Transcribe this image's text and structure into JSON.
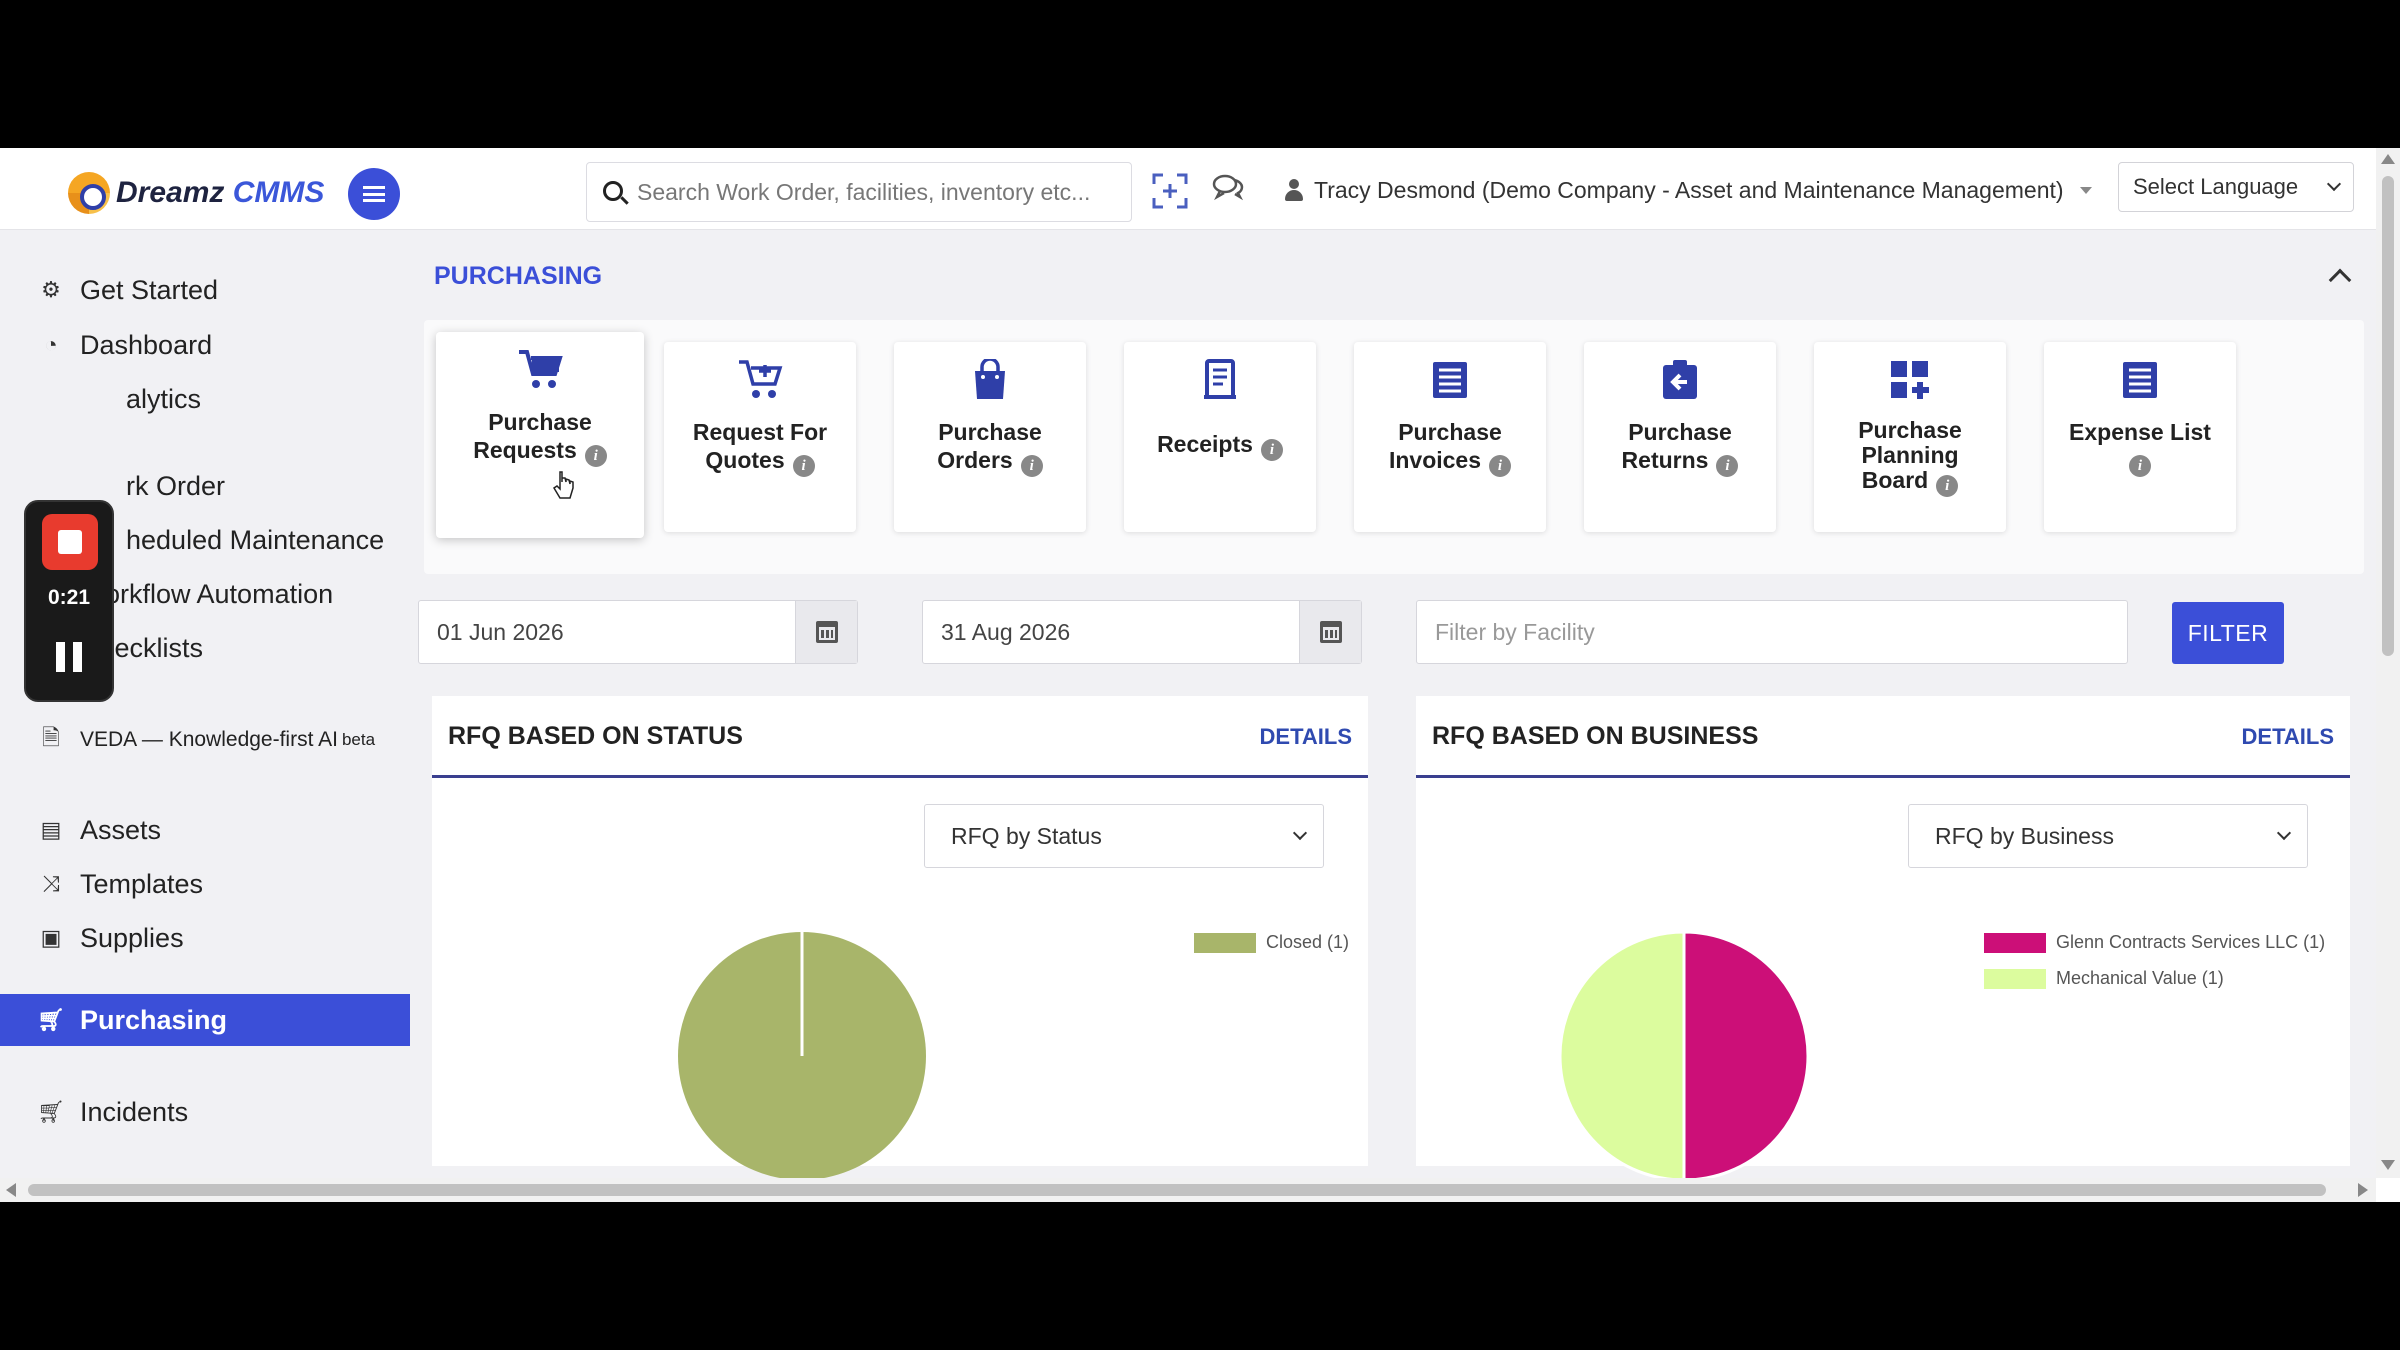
{
  "header": {
    "logo_primary": "Dreamz",
    "logo_accent": "CMMS",
    "search_placeholder": "Search Work Order, facilities, inventory etc...",
    "user_label": "Tracy Desmond (Demo Company - Asset and Maintenance Management)",
    "language_label": "Select Language"
  },
  "sidebar": {
    "items": [
      {
        "label": "Get Started",
        "icon": "gears-icon"
      },
      {
        "label": "Dashboard",
        "icon": "dashboard-icon"
      },
      {
        "label": "alytics",
        "icon": "analytics-icon"
      },
      {
        "label": "rk Order",
        "icon": "work-order-icon"
      },
      {
        "label": "heduled Maintenance",
        "icon": "scheduled-maintenance-icon"
      },
      {
        "label": "Workflow Automation",
        "icon": "workflow-icon"
      },
      {
        "label": "Checklists",
        "icon": "checkbox-icon"
      },
      {
        "label": "VEDA — Knowledge-first AI",
        "badge": "beta",
        "icon": "document-icon"
      },
      {
        "label": "Assets",
        "icon": "archive-icon"
      },
      {
        "label": "Templates",
        "icon": "shuffle-icon"
      },
      {
        "label": "Supplies",
        "icon": "briefcase-icon"
      },
      {
        "label": "Purchasing",
        "icon": "cart-icon",
        "active": true
      },
      {
        "label": "Incidents",
        "icon": "cart-icon"
      }
    ]
  },
  "recorder": {
    "time": "0:21"
  },
  "purchasing": {
    "title": "PURCHASING",
    "tiles": [
      {
        "line1": "Purchase",
        "line2": "Requests",
        "icon": "cart-icon"
      },
      {
        "line1": "Request For",
        "line2": "Quotes",
        "icon": "cart-plus-icon"
      },
      {
        "line1": "Purchase",
        "line2": "Orders",
        "icon": "shopping-bag-icon"
      },
      {
        "line1": "",
        "line2": "Receipts",
        "icon": "receipt-icon"
      },
      {
        "line1": "Purchase",
        "line2": "Invoices",
        "icon": "list-icon"
      },
      {
        "line1": "Purchase",
        "line2": "Returns",
        "icon": "return-icon"
      },
      {
        "line1": "Purchase",
        "line2": "Planning",
        "line3": "Board",
        "icon": "grid-plus-icon"
      },
      {
        "line1": "Expense List",
        "line2": "",
        "icon": "list-icon"
      }
    ]
  },
  "filters": {
    "start_date": "01 Jun 2026",
    "end_date": "31 Aug 2026",
    "facility_placeholder": "Filter by Facility",
    "filter_label": "FILTER"
  },
  "cards": [
    {
      "title": "RFQ BASED ON STATUS",
      "details": "DETAILS",
      "select": "RFQ by Status"
    },
    {
      "title": "RFQ BASED ON BUSINESS",
      "details": "DETAILS",
      "select": "RFQ by Business"
    }
  ],
  "chart_data": [
    {
      "type": "pie",
      "title": "",
      "categories": [
        "Closed (1)"
      ],
      "values": [
        1
      ],
      "colors": [
        "#a8b56a"
      ],
      "legend": "top-right"
    },
    {
      "type": "pie",
      "title": "",
      "categories": [
        "Glenn Contracts Services LLC (1)",
        "Mechanical Value (1)"
      ],
      "values": [
        1,
        1
      ],
      "colors": [
        "#cc0f78",
        "#dcfc9e"
      ],
      "legend": "top-right"
    }
  ],
  "colors": {
    "accent": "#3b4fd8",
    "sidebar_bg": "#f1f1f4"
  }
}
